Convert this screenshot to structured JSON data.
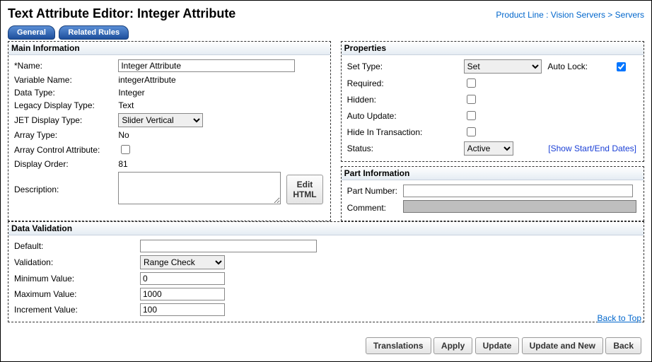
{
  "header": {
    "title": "Text Attribute Editor: Integer Attribute",
    "breadcrumb_prefix": "Product Line :",
    "breadcrumb1": "Vision Servers",
    "breadcrumb_sep": ">",
    "breadcrumb2": "Servers"
  },
  "tabs": {
    "general": "General",
    "related": "Related Rules"
  },
  "mainInfo": {
    "legend": "Main Information",
    "nameLabel": "*Name:",
    "nameValue": "Integer Attribute",
    "varNameLabel": "Variable Name:",
    "varNameValue": "integerAttribute",
    "dataTypeLabel": "Data Type:",
    "dataTypeValue": "Integer",
    "legacyLabel": "Legacy Display Type:",
    "legacyValue": "Text",
    "jetLabel": "JET Display Type:",
    "jetValue": "Slider Vertical",
    "arrayTypeLabel": "Array Type:",
    "arrayTypeValue": "No",
    "arrayCtrlLabel": "Array Control Attribute:",
    "displayOrderLabel": "Display Order:",
    "displayOrderValue": "81",
    "descriptionLabel": "Description:",
    "editHtml": "Edit HTML"
  },
  "properties": {
    "legend": "Properties",
    "setTypeLabel": "Set Type:",
    "setTypeValue": "Set",
    "autoLockLabel": "Auto Lock:",
    "requiredLabel": "Required:",
    "hiddenLabel": "Hidden:",
    "autoUpdateLabel": "Auto Update:",
    "hideTxnLabel": "Hide In Transaction:",
    "statusLabel": "Status:",
    "statusValue": "Active",
    "showDates": "[Show Start/End Dates]"
  },
  "partInfo": {
    "legend": "Part Information",
    "partNumberLabel": "Part Number:",
    "commentLabel": "Comment:"
  },
  "dataValidation": {
    "legend": "Data Validation",
    "defaultLabel": "Default:",
    "validationLabel": "Validation:",
    "validationValue": "Range Check",
    "minLabel": "Minimum Value:",
    "minValue": "0",
    "maxLabel": "Maximum Value:",
    "maxValue": "1000",
    "incLabel": "Increment Value:",
    "incValue": "100"
  },
  "footer": {
    "backToTop": "Back to Top",
    "translations": "Translations",
    "apply": "Apply",
    "update": "Update",
    "updateNew": "Update and New",
    "back": "Back"
  }
}
